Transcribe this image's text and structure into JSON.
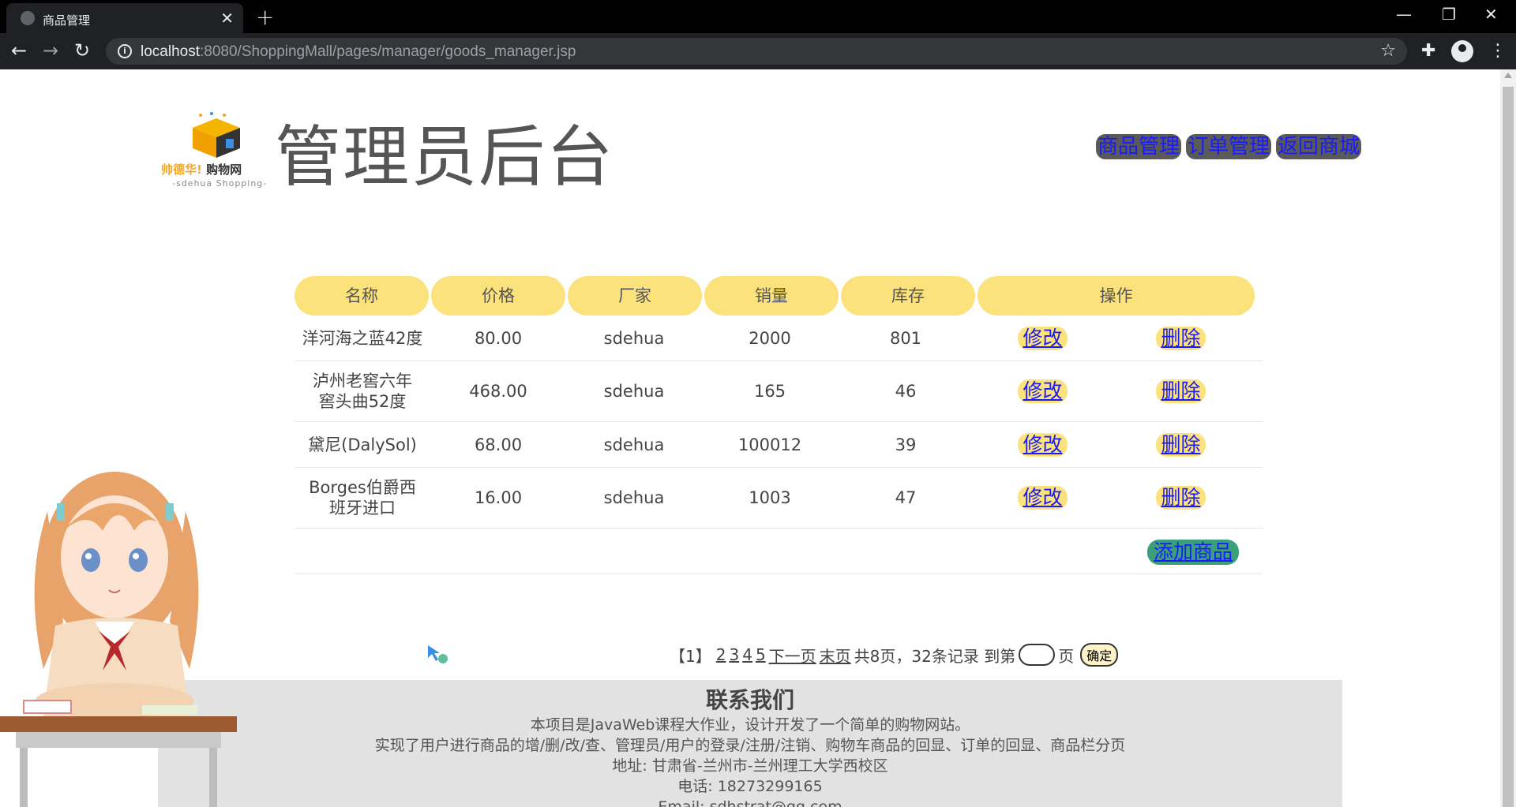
{
  "browser": {
    "tab_title": "商品管理",
    "url_host": "localhost",
    "url_rest": ":8080/ShoppingMall/pages/manager/goods_manager.jsp"
  },
  "header": {
    "logo_brand": "帅德华!",
    "logo_brand2": "购物网",
    "logo_sub": "-sdehua Shopping-",
    "title": "管理员后台",
    "nav": [
      "商品管理",
      "订单管理",
      "返回商城"
    ]
  },
  "table": {
    "columns": [
      "名称",
      "价格",
      "厂家",
      "销量",
      "库存",
      "操作"
    ],
    "rows": [
      {
        "name": "洋河海之蓝42度",
        "price": "80.00",
        "vendor": "sdehua",
        "sales": "2000",
        "stock": "801"
      },
      {
        "name": "泸州老窖六年窖头曲52度",
        "price": "468.00",
        "vendor": "sdehua",
        "sales": "165",
        "stock": "46"
      },
      {
        "name": "黛尼(DalySol)",
        "price": "68.00",
        "vendor": "sdehua",
        "sales": "100012",
        "stock": "39"
      },
      {
        "name": "Borges伯爵西班牙进口",
        "price": "16.00",
        "vendor": "sdehua",
        "sales": "1003",
        "stock": "47"
      }
    ],
    "edit_label": "修改",
    "delete_label": "删除",
    "add_label": "添加商品"
  },
  "pager": {
    "current": "【1】",
    "pages": [
      "2",
      "3",
      "4",
      "5"
    ],
    "next": "下一页",
    "last": "末页",
    "summary": "共8页，32条记录 到第",
    "page_suffix": "页",
    "confirm": "确定"
  },
  "footer": {
    "title": "联系我们",
    "lines": [
      "本项目是JavaWeb课程大作业，设计开发了一个简单的购物网站。",
      "实现了用户进行商品的增/删/改/查、管理员/用户的登录/注册/注销、购物车商品的回显、订单的回显、商品栏分页",
      "地址: 甘肃省-兰州市-兰州理工大学西校区",
      "电话: 18273299165",
      "Email: sdhstrat@qq.com"
    ]
  }
}
